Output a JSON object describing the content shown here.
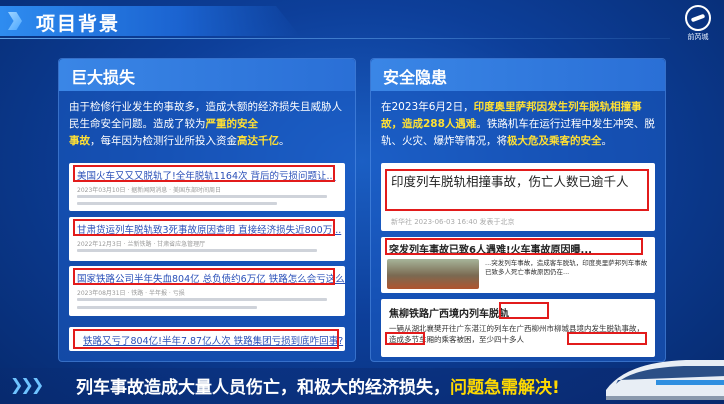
{
  "header": {
    "title": "项目背景",
    "logo_text": "前芮城"
  },
  "left_panel": {
    "title": "巨大损失",
    "intro_lines": [
      "由于检修行业发生的事故多，造成大额的经济损失",
      "且威胁人民生命安全问题。造成了较为",
      "严重的安全",
      "事故",
      "，每年因为检测行业所投入资金",
      "高达千亿",
      "。"
    ],
    "news": [
      {
        "title": "美国火车又又又脱轨了!全年脱轨1164次 背后的亏损问题让...",
        "meta": "2023年03月10日 · 据新闻网消息 · 美国东部时间周日"
      },
      {
        "title": "甘肃货运列车脱轨致3死事故原因查明 直接经济损失近800万...",
        "meta": "2022年12月3日 · 兰新铁路 · 甘肃省应急管理厅"
      },
      {
        "title": "国家铁路公司半年失血804亿 总负债约6万亿 铁路怎么会亏这么...",
        "meta": "2023年08月31日 · 铁路 · 半年报 · 亏损"
      },
      {
        "title": "铁路又亏了804亿!半年7.87亿人次 铁路集团亏损到底咋回事?",
        "meta": ""
      }
    ]
  },
  "right_panel": {
    "title": "安全隐患",
    "intro_prefix": "在2023年6月2日，",
    "intro_hl1": "印度奥里萨邦因发生列车脱轨相撞事故，造成288人遇难",
    "intro_mid": "。铁路机车在运行过程中发生冲突、脱轨、火灾、爆炸等情况，将",
    "intro_hl2": "极大危及乘客的安全",
    "intro_end": "。",
    "card1_title": "印度列车脱轨相撞事故，伤亡人数已逾千人",
    "card1_meta": "新华社  2023-06-03 16:40  发表于北京",
    "card2_title": "突发列车事故已致6人遇难!火车事故原因曝...",
    "card2_text": "...突发列车事故，造成客车脱轨，印度奥里萨邦列车事故已致多人死亡事故原因仍在...",
    "card3_title": "焦柳铁路广西境内列车脱轨",
    "card3_text": "一辆从湖北襄樊开往广东湛江的列车在广西柳州市柳城县境内发生脱轨事故，造成多节车厢的乘客被困，至少四十多人"
  },
  "bottom": {
    "text_main": "列车事故造成大量人员伤亡，和极大的经济损失，",
    "text_highlight": "问题急需解决!"
  },
  "colors": {
    "highlight_yellow": "#ffe033",
    "red_box": "#e21b1b",
    "panel_blue": "#2a6fd6"
  }
}
